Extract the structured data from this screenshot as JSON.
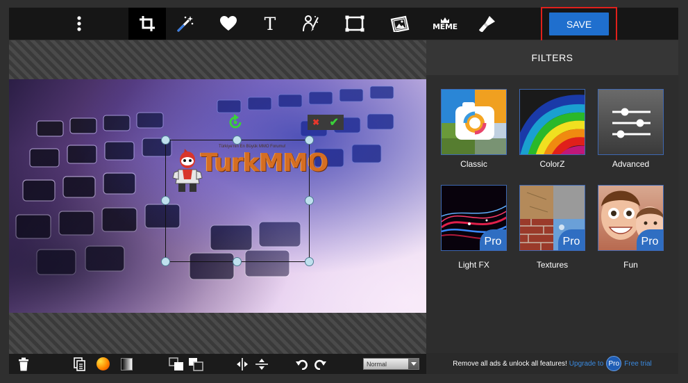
{
  "toolbar": {
    "tools": [
      {
        "name": "more-menu",
        "icon": "vertical-dots-icon"
      },
      {
        "name": "crop",
        "icon": "crop-icon",
        "active": true
      },
      {
        "name": "magic",
        "icon": "magic-wand-icon"
      },
      {
        "name": "stickers",
        "icon": "heart-icon"
      },
      {
        "name": "text",
        "icon": "text-icon",
        "label": "T"
      },
      {
        "name": "draw",
        "icon": "person-brush-icon"
      },
      {
        "name": "frames",
        "icon": "frame-icon"
      },
      {
        "name": "overlays",
        "icon": "image-overlay-icon"
      },
      {
        "name": "meme",
        "icon": "meme-crown-icon",
        "label": "MEME"
      },
      {
        "name": "retouch",
        "icon": "paint-brush-icon"
      }
    ],
    "save_label": "SAVE"
  },
  "editor": {
    "sticker": {
      "tagline": "Türkiye'nin En Büyük MMO Forumu!",
      "word": "TurkMMO"
    },
    "selection_actions": {
      "cancel": "✖",
      "confirm": "✔"
    }
  },
  "bottom_bar": {
    "icons": [
      "trash-icon",
      "duplicate-icon",
      "color-icon",
      "opacity-icon",
      "bring-front-icon",
      "send-back-icon",
      "flip-horizontal-icon",
      "flip-vertical-icon",
      "undo-icon",
      "redo-icon"
    ],
    "blend_mode": "Normal"
  },
  "filters": {
    "title": "FILTERS",
    "items": [
      {
        "label": "Classic",
        "pro": false
      },
      {
        "label": "ColorZ",
        "pro": false
      },
      {
        "label": "Advanced",
        "pro": false
      },
      {
        "label": "Light FX",
        "pro": true
      },
      {
        "label": "Textures",
        "pro": true
      },
      {
        "label": "Fun",
        "pro": true
      }
    ],
    "pro_badge": "Pro"
  },
  "promo": {
    "text": "Remove all ads & unlock all features!",
    "upgrade": "Upgrade to",
    "pro": "Pro",
    "trial": "Free trial"
  },
  "colors": {
    "accent": "#1f6fce",
    "highlight": "#e0201b",
    "toolbar_bg": "#161616",
    "panel_bg": "#2d2d2d"
  }
}
